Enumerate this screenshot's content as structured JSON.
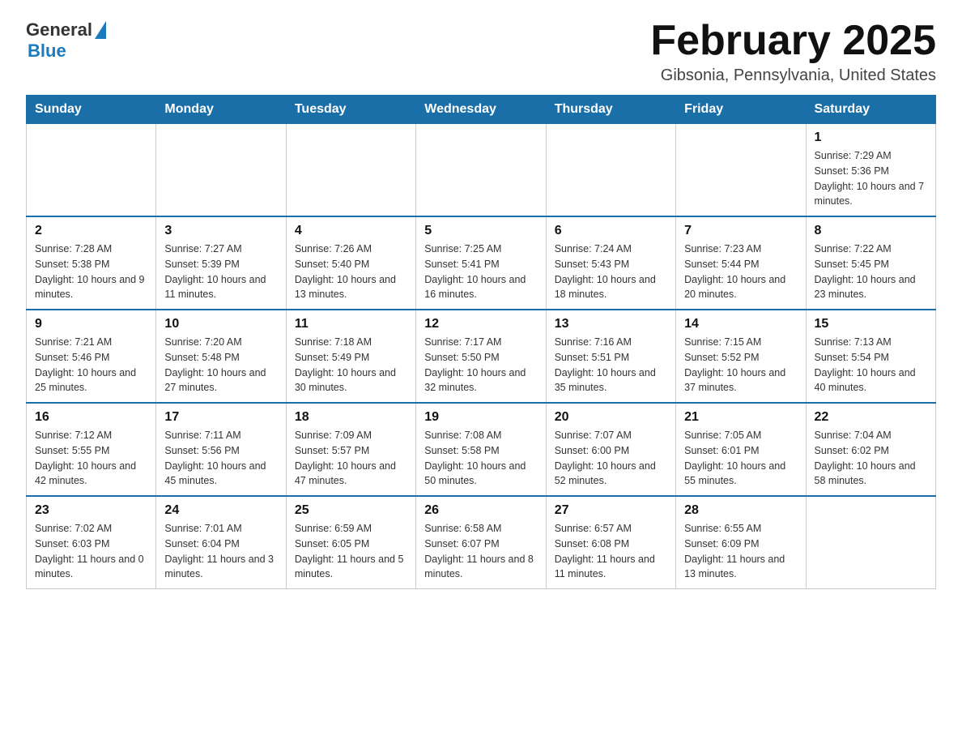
{
  "header": {
    "logo_general": "General",
    "logo_blue": "Blue",
    "title": "February 2025",
    "subtitle": "Gibsonia, Pennsylvania, United States"
  },
  "days_of_week": [
    "Sunday",
    "Monday",
    "Tuesday",
    "Wednesday",
    "Thursday",
    "Friday",
    "Saturday"
  ],
  "weeks": [
    [
      {
        "day": "",
        "info": ""
      },
      {
        "day": "",
        "info": ""
      },
      {
        "day": "",
        "info": ""
      },
      {
        "day": "",
        "info": ""
      },
      {
        "day": "",
        "info": ""
      },
      {
        "day": "",
        "info": ""
      },
      {
        "day": "1",
        "info": "Sunrise: 7:29 AM\nSunset: 5:36 PM\nDaylight: 10 hours and 7 minutes."
      }
    ],
    [
      {
        "day": "2",
        "info": "Sunrise: 7:28 AM\nSunset: 5:38 PM\nDaylight: 10 hours and 9 minutes."
      },
      {
        "day": "3",
        "info": "Sunrise: 7:27 AM\nSunset: 5:39 PM\nDaylight: 10 hours and 11 minutes."
      },
      {
        "day": "4",
        "info": "Sunrise: 7:26 AM\nSunset: 5:40 PM\nDaylight: 10 hours and 13 minutes."
      },
      {
        "day": "5",
        "info": "Sunrise: 7:25 AM\nSunset: 5:41 PM\nDaylight: 10 hours and 16 minutes."
      },
      {
        "day": "6",
        "info": "Sunrise: 7:24 AM\nSunset: 5:43 PM\nDaylight: 10 hours and 18 minutes."
      },
      {
        "day": "7",
        "info": "Sunrise: 7:23 AM\nSunset: 5:44 PM\nDaylight: 10 hours and 20 minutes."
      },
      {
        "day": "8",
        "info": "Sunrise: 7:22 AM\nSunset: 5:45 PM\nDaylight: 10 hours and 23 minutes."
      }
    ],
    [
      {
        "day": "9",
        "info": "Sunrise: 7:21 AM\nSunset: 5:46 PM\nDaylight: 10 hours and 25 minutes."
      },
      {
        "day": "10",
        "info": "Sunrise: 7:20 AM\nSunset: 5:48 PM\nDaylight: 10 hours and 27 minutes."
      },
      {
        "day": "11",
        "info": "Sunrise: 7:18 AM\nSunset: 5:49 PM\nDaylight: 10 hours and 30 minutes."
      },
      {
        "day": "12",
        "info": "Sunrise: 7:17 AM\nSunset: 5:50 PM\nDaylight: 10 hours and 32 minutes."
      },
      {
        "day": "13",
        "info": "Sunrise: 7:16 AM\nSunset: 5:51 PM\nDaylight: 10 hours and 35 minutes."
      },
      {
        "day": "14",
        "info": "Sunrise: 7:15 AM\nSunset: 5:52 PM\nDaylight: 10 hours and 37 minutes."
      },
      {
        "day": "15",
        "info": "Sunrise: 7:13 AM\nSunset: 5:54 PM\nDaylight: 10 hours and 40 minutes."
      }
    ],
    [
      {
        "day": "16",
        "info": "Sunrise: 7:12 AM\nSunset: 5:55 PM\nDaylight: 10 hours and 42 minutes."
      },
      {
        "day": "17",
        "info": "Sunrise: 7:11 AM\nSunset: 5:56 PM\nDaylight: 10 hours and 45 minutes."
      },
      {
        "day": "18",
        "info": "Sunrise: 7:09 AM\nSunset: 5:57 PM\nDaylight: 10 hours and 47 minutes."
      },
      {
        "day": "19",
        "info": "Sunrise: 7:08 AM\nSunset: 5:58 PM\nDaylight: 10 hours and 50 minutes."
      },
      {
        "day": "20",
        "info": "Sunrise: 7:07 AM\nSunset: 6:00 PM\nDaylight: 10 hours and 52 minutes."
      },
      {
        "day": "21",
        "info": "Sunrise: 7:05 AM\nSunset: 6:01 PM\nDaylight: 10 hours and 55 minutes."
      },
      {
        "day": "22",
        "info": "Sunrise: 7:04 AM\nSunset: 6:02 PM\nDaylight: 10 hours and 58 minutes."
      }
    ],
    [
      {
        "day": "23",
        "info": "Sunrise: 7:02 AM\nSunset: 6:03 PM\nDaylight: 11 hours and 0 minutes."
      },
      {
        "day": "24",
        "info": "Sunrise: 7:01 AM\nSunset: 6:04 PM\nDaylight: 11 hours and 3 minutes."
      },
      {
        "day": "25",
        "info": "Sunrise: 6:59 AM\nSunset: 6:05 PM\nDaylight: 11 hours and 5 minutes."
      },
      {
        "day": "26",
        "info": "Sunrise: 6:58 AM\nSunset: 6:07 PM\nDaylight: 11 hours and 8 minutes."
      },
      {
        "day": "27",
        "info": "Sunrise: 6:57 AM\nSunset: 6:08 PM\nDaylight: 11 hours and 11 minutes."
      },
      {
        "day": "28",
        "info": "Sunrise: 6:55 AM\nSunset: 6:09 PM\nDaylight: 11 hours and 13 minutes."
      },
      {
        "day": "",
        "info": ""
      }
    ]
  ]
}
